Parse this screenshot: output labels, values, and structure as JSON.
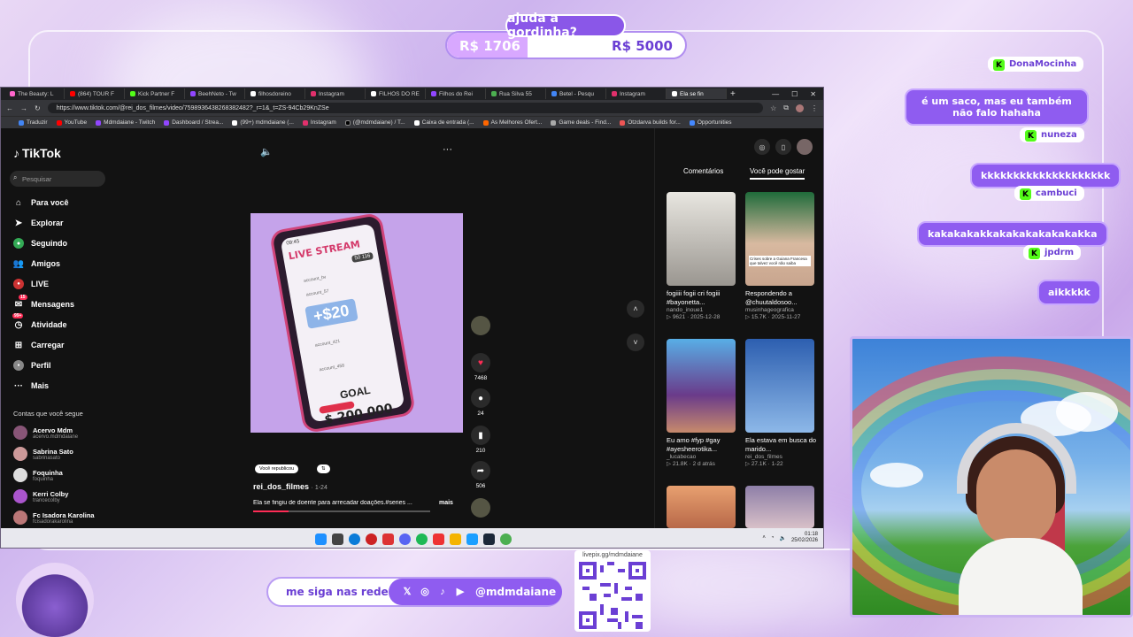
{
  "goal": {
    "title": "ajuda a gordinha?",
    "current": "R$ 1706",
    "target": "R$ 5000",
    "progress": 0.34
  },
  "browser": {
    "tabs": [
      "The Beauty: L",
      "(864) TOUR F",
      "Kick Partner F",
      "BeehNeto - Tw",
      "filhosdoreino",
      "Instagram",
      "FILHOS DO RE",
      "Filhos do Rei",
      "Rua Silva 55",
      "Betel - Pesqu",
      "Instagram",
      "Ela se fin"
    ],
    "url": "https://www.tiktok.com/@rei_dos_filmes/video/7598936438268382482?_r=1&_t=ZS-94Cb29KnZSe",
    "bookmarks": [
      "Traduzir",
      "YouTube",
      "Mdmdaiane - Twitch",
      "Dashboard / Strea...",
      "(99+) mdmdaiane (...",
      "Instagram",
      "(@mdmdaiane) / T...",
      "Caixa de entrada (...",
      "As Melhores Ofert...",
      "Game deals - Find...",
      "Otzdarva builds for...",
      "Opportunities"
    ]
  },
  "tiktok": {
    "logo": "TikTok",
    "search_placeholder": "Pesquisar",
    "nav": [
      "Para você",
      "Explorar",
      "Seguindo",
      "Amigos",
      "LIVE",
      "Mensagens",
      "Atividade",
      "Carregar",
      "Perfil",
      "Mais"
    ],
    "badges": {
      "messages": "15",
      "activity": "99+"
    },
    "following_header": "Contas que você segue",
    "following": [
      {
        "name": "Acervo Mdm",
        "handle": "acervo.mdmdaiane"
      },
      {
        "name": "Sabrina Sato",
        "handle": "sabrinasato"
      },
      {
        "name": "Foquinha",
        "handle": "foquinha"
      },
      {
        "name": "Kerri Colby",
        "handle": "trancecolby"
      },
      {
        "name": "Fc Isadora Karolina",
        "handle": "fcisadorakarolina"
      }
    ],
    "video": {
      "live_stream": "LIVE STREAM",
      "viewers": "50 116",
      "money": "+$20",
      "accounts": [
        "account_bv",
        "account_57",
        "account_421",
        "account_458"
      ],
      "goal_label": "GOAL",
      "goal_amount": "$ 200 000",
      "time": "09:45"
    },
    "actions": {
      "likes": "7468",
      "comments": "24",
      "saves": "210",
      "shares": "506"
    },
    "republished_chip": "Você republicou",
    "author": "rei_dos_filmes",
    "date": "1-24",
    "caption": "Ela se fingiu de doente para arrecadar doações.#series ...",
    "more": "mais",
    "right_tabs": [
      "Comentários",
      "Você pode gostar"
    ],
    "suggestions": [
      {
        "title": "fogiiii fogii cri fogiii #bayonetta...",
        "user": "nando_inoue1",
        "views": "9621",
        "date": "2025-12-28"
      },
      {
        "title": "Respondendo a @chuutaldosoo...",
        "user": "musinhageografica",
        "views": "15.7K",
        "date": "2025-11-27"
      },
      {
        "title": "Eu amo #fyp #gay #ayesheerotika...",
        "user": "_lucabecao",
        "views": "21.8K",
        "date": "2 d atrás"
      },
      {
        "title": "Ela estava em busca do marido...",
        "user": "rei_dos_filmes",
        "views": "27.1K",
        "date": "1-22"
      }
    ],
    "thumb_text_2": "Crises sobre a Guiana Francesa que talvez você não saiba"
  },
  "taskbar": {
    "time": "01:18",
    "date": "25/02/2026"
  },
  "chat": [
    {
      "user": "DonaMocinha",
      "message": "é um saco, mas eu também não falo hahaha"
    },
    {
      "user": "nuneza",
      "message": "kkkkkkkkkkkkkkkkkkkk"
    },
    {
      "user": "cambuci",
      "message": "kakakakakkakakakakakakakka"
    },
    {
      "user": "jpdrm",
      "message": "aikkkkk"
    }
  ],
  "social": {
    "label": "me siga nas redes",
    "handle": "@mdmdaiane",
    "qr_url": "livepix.gg/mdmdaiane"
  },
  "colors": {
    "accent": "#8f5cf0",
    "kick": "#53fc18",
    "bg": "#e9d8f5"
  }
}
